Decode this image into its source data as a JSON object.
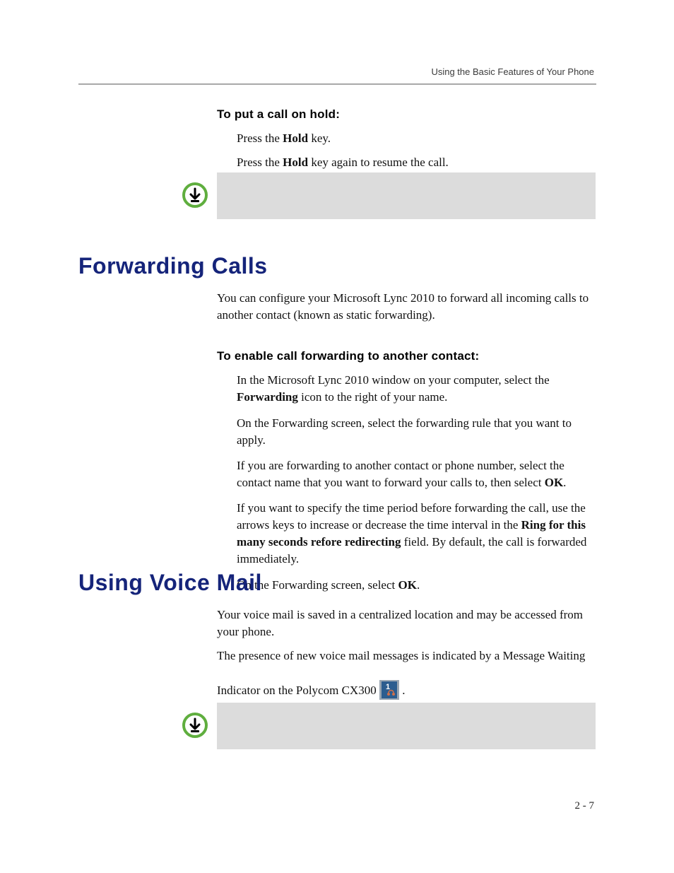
{
  "header": {
    "running_head": "Using the Basic Features of Your Phone"
  },
  "hold_section": {
    "heading": "To put a call on hold:",
    "step1_pre": "Press the ",
    "step1_bold": "Hold",
    "step1_post": " key.",
    "step2_pre": "Press the ",
    "step2_bold": "Hold",
    "step2_post": " key again to resume the call."
  },
  "forwarding": {
    "title": "Forwarding Calls",
    "intro": "You can configure your Microsoft Lync 2010 to forward all incoming calls to another contact (known as static forwarding).",
    "heading": "To enable call forwarding to another contact:",
    "step1_pre": "In the Microsoft Lync 2010 window on your computer, select the ",
    "step1_bold": "Forwarding",
    "step1_post": " icon to the right of your name.",
    "step2": "On the Forwarding screen, select the forwarding rule that you want to apply.",
    "step3_pre": "If you are forwarding to another contact or phone number, select the contact name that you want to forward your calls to, then select ",
    "step3_bold": "OK",
    "step3_post": ".",
    "step4_pre": "If you want to specify the time period before forwarding the call, use the arrows keys to increase or decrease the time interval in the ",
    "step4_bold": "Ring for this many seconds refore redirecting",
    "step4_post": " field. By default, the call is forwarded immediately.",
    "step5_pre": "On the Forwarding screen, select ",
    "step5_bold": "OK",
    "step5_post": "."
  },
  "voicemail": {
    "title": "Using Voice Mail",
    "p1": "Your voice mail is saved in a centralized location and may be accessed from your phone.",
    "p2_line1": "The presence of new voice mail messages is indicated by a Message Waiting",
    "p2_line2_pre": "Indicator on the Polycom CX300 ",
    "p2_line2_post": "."
  },
  "page_number": "2 - 7",
  "icons": {
    "note": "note-icon",
    "mwi_badge": "1"
  }
}
